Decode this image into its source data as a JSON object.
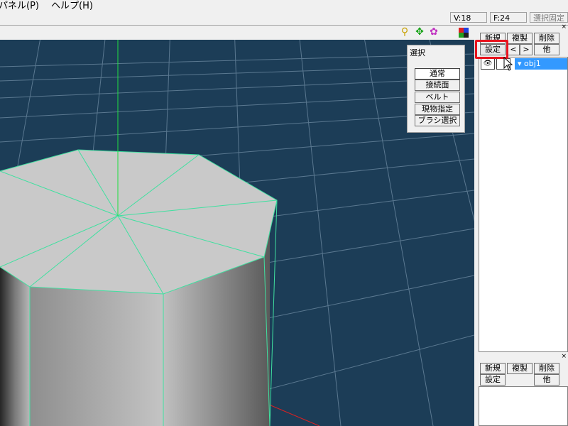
{
  "menu": {
    "items": [
      "パネル(P)",
      "ヘルプ(H)"
    ]
  },
  "status": {
    "vertices": "V:18",
    "faces": "F:24",
    "lock_label": "選択固定"
  },
  "viewport": {
    "icons": [
      "zoom-icon",
      "move-icon",
      "rotate-icon",
      "color-icon"
    ]
  },
  "select_panel": {
    "title": "選択",
    "buttons": [
      "通常",
      "接続面",
      "ベルト",
      "現物指定",
      "ブラシ選択"
    ],
    "active_index": 0
  },
  "object_panel": {
    "close": "×",
    "new_label": "新規",
    "copy_label": "複製",
    "delete_label": "削除",
    "settings_label": "設定",
    "prev_label": "<",
    "next_label": ">",
    "other_label": "他",
    "objects": [
      {
        "name": "obj1",
        "expanded": true
      }
    ]
  },
  "material_panel": {
    "close": "×",
    "new_label": "新規",
    "copy_label": "複製",
    "delete_label": "削除",
    "settings_label": "設定",
    "other_label": "他"
  },
  "colors": {
    "viewport_bg": "#1c3d57",
    "grid": "#5a7890",
    "edge": "#40e0a0",
    "selection": "#3399ff",
    "highlight": "#e8141e"
  }
}
